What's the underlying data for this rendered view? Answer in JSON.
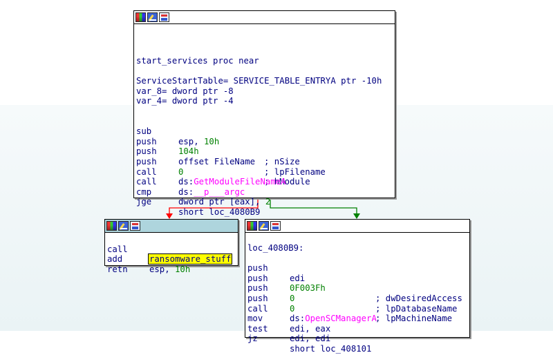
{
  "colors": {
    "true_edge": "#008000",
    "false_edge": "#ff0000",
    "mnemonic": "#000080",
    "number": "#008000",
    "import": "#ff00ff",
    "selected_header": "#aed5dd",
    "highlight": "#ffff00"
  },
  "node_icons": [
    "color-palette-icon",
    "rename-node-icon",
    "graph-overview-icon"
  ],
  "nodes": {
    "top": {
      "proc": "start_services proc near",
      "vars": [
        "ServiceStartTable= SERVICE_TABLE_ENTRYA ptr -10h",
        "var_8= dword ptr -8",
        "var_4= dword ptr -4"
      ],
      "insns": [
        {
          "mn": "sub",
          "op_a": "esp, ",
          "num": "10h",
          "op_b": "",
          "cmt": ""
        },
        {
          "mn": "push",
          "num": "104h",
          "cmt": "; nSize"
        },
        {
          "mn": "push",
          "op_a": "offset FileName",
          "cmt": "; lpFilename"
        },
        {
          "mn": "push",
          "num": "0",
          "cmt": "; hModule"
        },
        {
          "mn": "call",
          "prefix": "ds:",
          "fn": "GetModuleFileNameA"
        },
        {
          "mn": "call",
          "prefix": "ds:",
          "fn": "__p___argc"
        },
        {
          "mn": "cmp",
          "op_a": "dword ptr [eax], ",
          "num": "2"
        },
        {
          "mn": "jge",
          "op_a": "short loc_4080B9"
        }
      ]
    },
    "left": {
      "insns": [
        {
          "mn": "call",
          "highlight": "ransomware_stuff"
        },
        {
          "mn": "add",
          "op_a": "esp, ",
          "num": "10h"
        },
        {
          "mn": "retn"
        }
      ]
    },
    "right": {
      "label": "loc_4080B9:",
      "insns": [
        {
          "mn": "push",
          "op_a": "edi"
        },
        {
          "mn": "push",
          "num": "0F003Fh",
          "cmt": "; dwDesiredAccess"
        },
        {
          "mn": "push",
          "num": "0",
          "cmt": "; lpDatabaseName"
        },
        {
          "mn": "push",
          "num": "0",
          "cmt": "; lpMachineName"
        },
        {
          "mn": "call",
          "prefix": "ds:",
          "fn": "OpenSCManagerA"
        },
        {
          "mn": "mov",
          "op_a": "edi, eax"
        },
        {
          "mn": "test",
          "op_a": "edi, edi"
        },
        {
          "mn": "jz",
          "op_a": "short loc_408101"
        }
      ]
    }
  }
}
